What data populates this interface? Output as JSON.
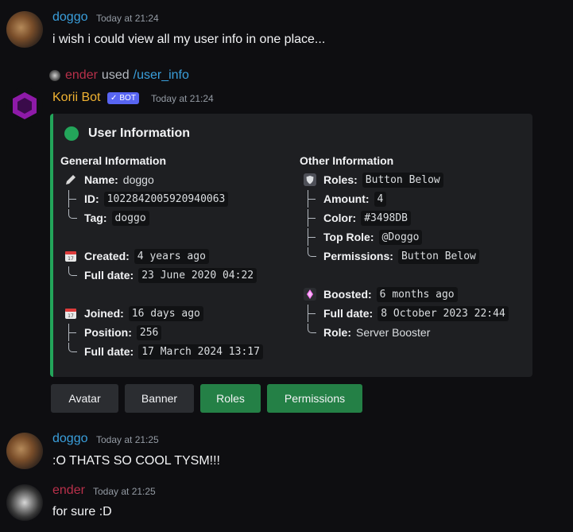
{
  "messages": [
    {
      "author": "doggo",
      "time": "Today at 21:24",
      "text": "i wish i could view all my user info in one place..."
    },
    {
      "author": "doggo",
      "time": "Today at 21:25",
      "text": ":O THATS SO COOL TYSM!!!"
    },
    {
      "author": "ender",
      "time": "Today at 21:25",
      "text": "for sure :D"
    }
  ],
  "command": {
    "user": "ender",
    "used": "used",
    "name": "/user_info"
  },
  "bot": {
    "name": "Korii Bot",
    "badge": "BOT",
    "time": "Today at 21:24"
  },
  "embed": {
    "title": "User Information",
    "accent": "#23a55a",
    "general": {
      "heading": "General Information",
      "name_k": "Name:",
      "name_v": "doggo",
      "id_k": "ID:",
      "id_v": "1022842005920940063",
      "tag_k": "Tag:",
      "tag_v": "doggo",
      "created_k": "Created:",
      "created_v": "4 years ago",
      "created_full_k": "Full date:",
      "created_full_v": "23 June 2020 04:22",
      "joined_k": "Joined:",
      "joined_v": "16 days ago",
      "position_k": "Position:",
      "position_v": "256",
      "joined_full_k": "Full date:",
      "joined_full_v": "17 March 2024 13:17"
    },
    "other": {
      "heading": "Other Information",
      "roles_k": "Roles:",
      "roles_v": "Button Below",
      "amount_k": "Amount:",
      "amount_v": "4",
      "color_k": "Color:",
      "color_v": "#3498DB",
      "top_k": "Top Role:",
      "top_v": "@Doggo",
      "perm_k": "Permissions:",
      "perm_v": "Button Below",
      "boosted_k": "Boosted:",
      "boosted_v": "6 months ago",
      "boost_full_k": "Full date:",
      "boost_full_v": "8 October 2023 22:44",
      "role_k": "Role:",
      "role_v": "Server Booster"
    }
  },
  "buttons": {
    "avatar": "Avatar",
    "banner": "Banner",
    "roles": "Roles",
    "permissions": "Permissions"
  },
  "colors": {
    "doggo": "#3a9fdc",
    "ender": "#b8304a",
    "korii": "#f0b232",
    "slash": "#3a9fdc",
    "badge": "#5865f2"
  }
}
